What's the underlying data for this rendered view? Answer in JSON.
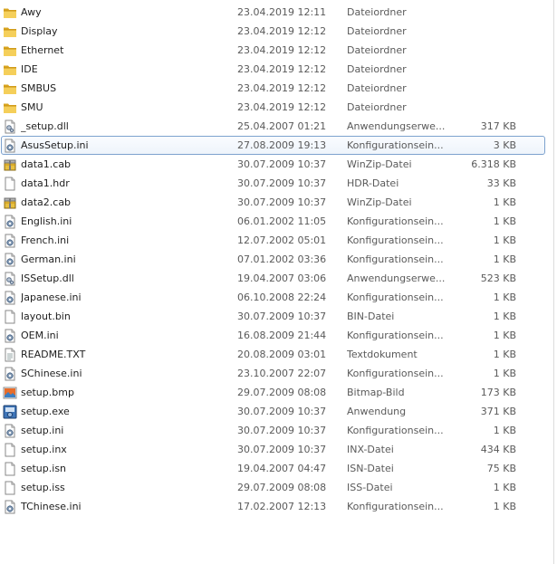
{
  "files": [
    {
      "name": "Awy",
      "date": "23.04.2019 12:11",
      "type": "Dateiordner",
      "size": "",
      "icon": "folder-icon"
    },
    {
      "name": "Display",
      "date": "23.04.2019 12:12",
      "type": "Dateiordner",
      "size": "",
      "icon": "folder-icon"
    },
    {
      "name": "Ethernet",
      "date": "23.04.2019 12:12",
      "type": "Dateiordner",
      "size": "",
      "icon": "folder-icon"
    },
    {
      "name": "IDE",
      "date": "23.04.2019 12:12",
      "type": "Dateiordner",
      "size": "",
      "icon": "folder-icon"
    },
    {
      "name": "SMBUS",
      "date": "23.04.2019 12:12",
      "type": "Dateiordner",
      "size": "",
      "icon": "folder-icon"
    },
    {
      "name": "SMU",
      "date": "23.04.2019 12:12",
      "type": "Dateiordner",
      "size": "",
      "icon": "folder-icon"
    },
    {
      "name": "_setup.dll",
      "date": "25.04.2007 01:21",
      "type": "Anwendungserwe...",
      "size": "317 KB",
      "icon": "dll-file-icon"
    },
    {
      "name": "AsusSetup.ini",
      "date": "27.08.2009 19:13",
      "type": "Konfigurationsein...",
      "size": "3 KB",
      "icon": "ini-file-icon",
      "selected": true
    },
    {
      "name": "data1.cab",
      "date": "30.07.2009 10:37",
      "type": "WinZip-Datei",
      "size": "6.318 KB",
      "icon": "winzip-file-icon"
    },
    {
      "name": "data1.hdr",
      "date": "30.07.2009 10:37",
      "type": "HDR-Datei",
      "size": "33 KB",
      "icon": "generic-file-icon"
    },
    {
      "name": "data2.cab",
      "date": "30.07.2009 10:37",
      "type": "WinZip-Datei",
      "size": "1 KB",
      "icon": "winzip-file-icon"
    },
    {
      "name": "English.ini",
      "date": "06.01.2002 11:05",
      "type": "Konfigurationsein...",
      "size": "1 KB",
      "icon": "ini-file-icon"
    },
    {
      "name": "French.ini",
      "date": "12.07.2002 05:01",
      "type": "Konfigurationsein...",
      "size": "1 KB",
      "icon": "ini-file-icon"
    },
    {
      "name": "German.ini",
      "date": "07.01.2002 03:36",
      "type": "Konfigurationsein...",
      "size": "1 KB",
      "icon": "ini-file-icon"
    },
    {
      "name": "ISSetup.dll",
      "date": "19.04.2007 03:06",
      "type": "Anwendungserwe...",
      "size": "523 KB",
      "icon": "dll-file-icon"
    },
    {
      "name": "Japanese.ini",
      "date": "06.10.2008 22:24",
      "type": "Konfigurationsein...",
      "size": "1 KB",
      "icon": "ini-file-icon"
    },
    {
      "name": "layout.bin",
      "date": "30.07.2009 10:37",
      "type": "BIN-Datei",
      "size": "1 KB",
      "icon": "generic-file-icon"
    },
    {
      "name": "OEM.ini",
      "date": "16.08.2009 21:44",
      "type": "Konfigurationsein...",
      "size": "1 KB",
      "icon": "ini-file-icon"
    },
    {
      "name": "README.TXT",
      "date": "20.08.2009 03:01",
      "type": "Textdokument",
      "size": "1 KB",
      "icon": "text-file-icon"
    },
    {
      "name": "SChinese.ini",
      "date": "23.10.2007 22:07",
      "type": "Konfigurationsein...",
      "size": "1 KB",
      "icon": "ini-file-icon"
    },
    {
      "name": "setup.bmp",
      "date": "29.07.2009 08:08",
      "type": "Bitmap-Bild",
      "size": "173 KB",
      "icon": "bitmap-file-icon"
    },
    {
      "name": "setup.exe",
      "date": "30.07.2009 10:37",
      "type": "Anwendung",
      "size": "371 KB",
      "icon": "setup-exe-icon"
    },
    {
      "name": "setup.ini",
      "date": "30.07.2009 10:37",
      "type": "Konfigurationsein...",
      "size": "1 KB",
      "icon": "ini-file-icon"
    },
    {
      "name": "setup.inx",
      "date": "30.07.2009 10:37",
      "type": "INX-Datei",
      "size": "434 KB",
      "icon": "generic-file-icon"
    },
    {
      "name": "setup.isn",
      "date": "19.04.2007 04:47",
      "type": "ISN-Datei",
      "size": "75 KB",
      "icon": "generic-file-icon"
    },
    {
      "name": "setup.iss",
      "date": "29.07.2009 08:08",
      "type": "ISS-Datei",
      "size": "1 KB",
      "icon": "generic-file-icon"
    },
    {
      "name": "TChinese.ini",
      "date": "17.02.2007 12:13",
      "type": "Konfigurationsein...",
      "size": "1 KB",
      "icon": "ini-file-icon"
    }
  ],
  "colors": {
    "folder": "#e8b83a",
    "selection_border": "#7da2ce",
    "secondary_text": "#5a5a5a"
  }
}
